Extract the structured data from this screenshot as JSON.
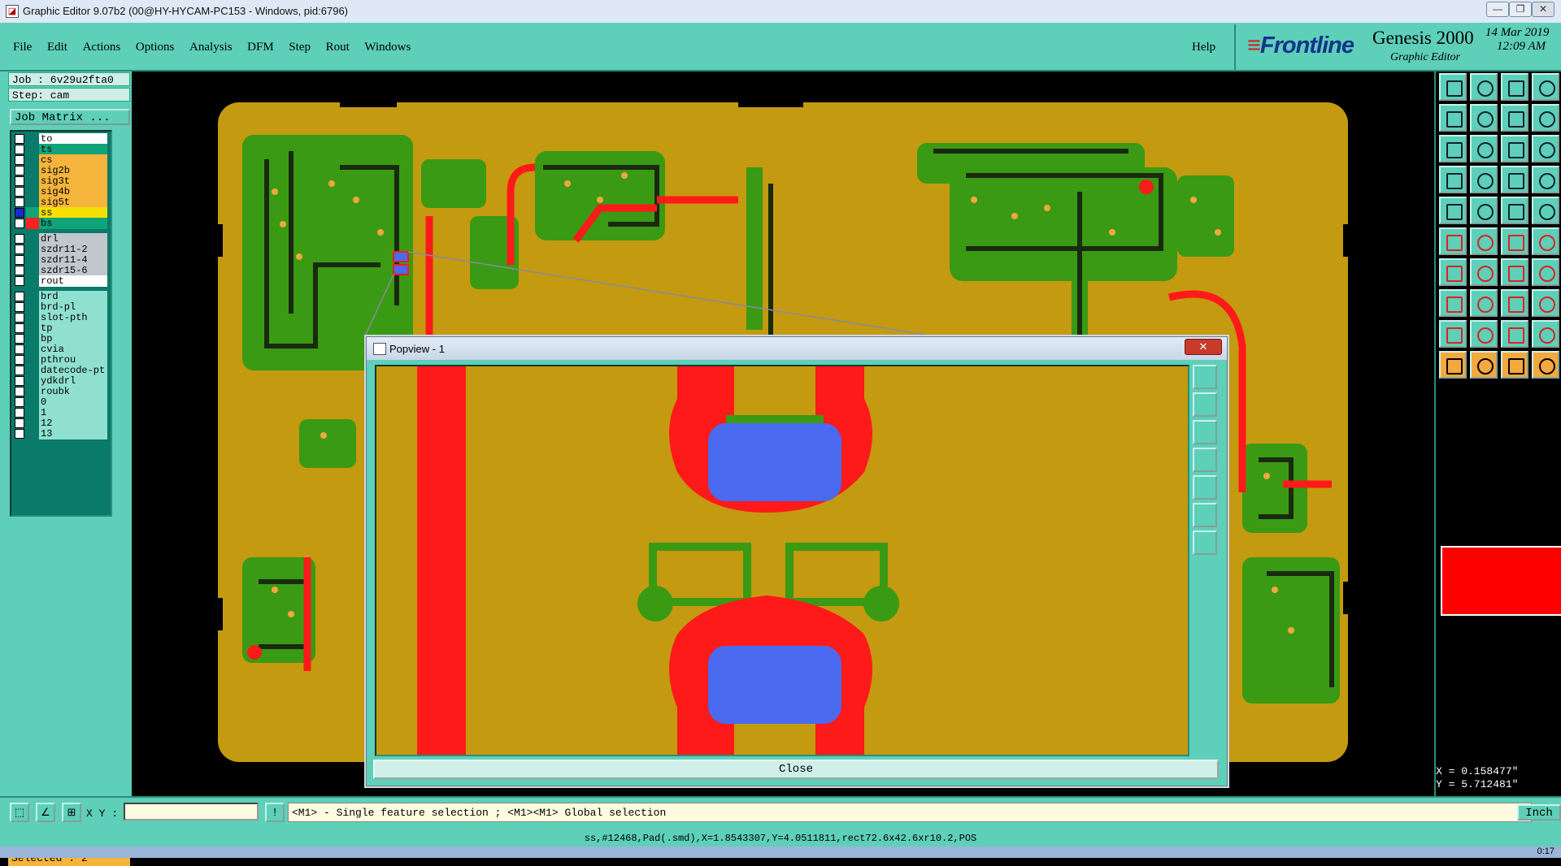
{
  "window": {
    "title": "Graphic Editor 9.07b2 (00@HY-HYCAM-PC153 - Windows, pid:6796)",
    "buttons": [
      "—",
      "❐",
      "✕"
    ]
  },
  "menu": {
    "items": [
      "File",
      "Edit",
      "Actions",
      "Options",
      "Analysis",
      "DFM",
      "Step",
      "Rout",
      "Windows"
    ],
    "help": "Help"
  },
  "brand": {
    "logo": "Frontline",
    "product": "Genesis 2000",
    "subtitle": "Graphic Editor",
    "date": "14 Mar 2019",
    "time": "12:09 AM"
  },
  "job": {
    "job_label": "Job : 6v29u2fta0",
    "step_label": "Step: cam",
    "matrix_button": "Job Matrix ..."
  },
  "layers": [
    {
      "name": "to",
      "color": "#ffffff",
      "check": "empty"
    },
    {
      "name": "ts",
      "color": "#11a37a",
      "check": "empty"
    },
    {
      "name": "cs",
      "color": "#f5b43c",
      "check": "empty"
    },
    {
      "name": "sig2b",
      "color": "#f5b43c",
      "check": "empty"
    },
    {
      "name": "sig3t",
      "color": "#f5b43c",
      "check": "empty"
    },
    {
      "name": "sig4b",
      "color": "#f5b43c",
      "check": "empty"
    },
    {
      "name": "sig5t",
      "color": "#f5b43c",
      "check": "empty"
    },
    {
      "name": "ss",
      "color": "#f5e000",
      "check": "blue",
      "swatch": "#11a37a"
    },
    {
      "name": "bs",
      "color": "#11a37a",
      "check": "empty",
      "swatch": "#ff2020"
    },
    {
      "name": "drl",
      "color": "#c0c8cc",
      "check": "empty"
    },
    {
      "name": "szdr11-2",
      "color": "#c0c8cc",
      "check": "empty"
    },
    {
      "name": "szdr11-4",
      "color": "#c0c8cc",
      "check": "empty"
    },
    {
      "name": "szdr15-6",
      "color": "#c0c8cc",
      "check": "empty"
    },
    {
      "name": "rout",
      "color": "#ffffff",
      "check": "empty"
    },
    {
      "name": "brd",
      "color": "#8fe0d0",
      "check": "empty"
    },
    {
      "name": "brd-pl",
      "color": "#8fe0d0",
      "check": "empty"
    },
    {
      "name": "slot-pth",
      "color": "#8fe0d0",
      "check": "empty"
    },
    {
      "name": "tp",
      "color": "#8fe0d0",
      "check": "empty"
    },
    {
      "name": "bp",
      "color": "#8fe0d0",
      "check": "empty"
    },
    {
      "name": "cvia",
      "color": "#8fe0d0",
      "check": "empty"
    },
    {
      "name": "pthrou",
      "color": "#8fe0d0",
      "check": "empty"
    },
    {
      "name": "datecode-pt",
      "color": "#8fe0d0",
      "check": "empty"
    },
    {
      "name": "ydkdrl",
      "color": "#8fe0d0",
      "check": "empty"
    },
    {
      "name": "roubk",
      "color": "#8fe0d0",
      "check": "empty"
    },
    {
      "name": "0",
      "color": "#8fe0d0",
      "check": "empty"
    },
    {
      "name": "1",
      "color": "#8fe0d0",
      "check": "empty"
    },
    {
      "name": "12",
      "color": "#8fe0d0",
      "check": "empty"
    },
    {
      "name": "13",
      "color": "#8fe0d0",
      "check": "empty"
    }
  ],
  "selected": "Selected : 2",
  "coords": {
    "x": "X = 0.158477\"",
    "y": "Y = 5.712481\""
  },
  "bottom": {
    "xy_label": "X Y :",
    "xy_value": "",
    "hint": "<M1> - Single feature selection ; <M1><M1> Global selection",
    "units": "Inch",
    "status": "ss,#12468,Pad(.smd),X=1.8543307,Y=4.0511811,rect72.6x42.6xr10.2,POS"
  },
  "popview": {
    "title": "Popview - 1",
    "close_label": "Close"
  },
  "taskbar": {
    "clock": "0:17"
  },
  "colors": {
    "panel": "#5ecfb8",
    "board": "#c49a10",
    "copper": "#3a9a14",
    "trace": "#ff1a1a",
    "pad": "#4a6af0"
  }
}
